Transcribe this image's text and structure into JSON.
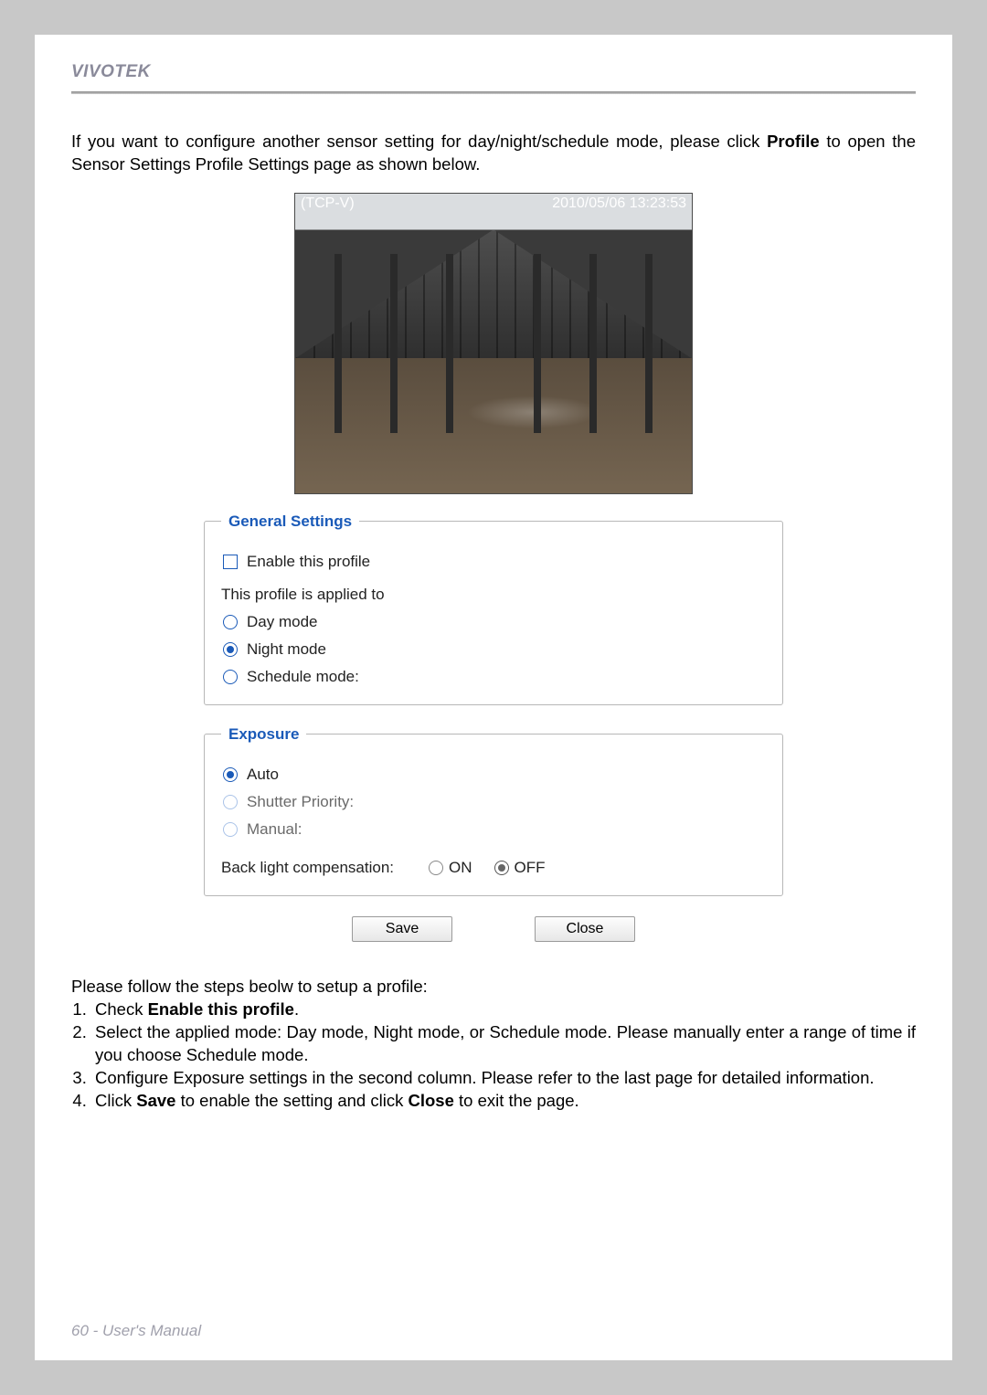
{
  "brand": "VIVOTEK",
  "intro_part1": "If you want to configure another sensor setting for day/night/schedule mode, please click ",
  "intro_profile": "Profile",
  "intro_part2": " to open the Sensor Settings Profile Settings page as shown below.",
  "camera": {
    "label_left": "(TCP-V)",
    "timestamp": "2010/05/06 13:23:53"
  },
  "general": {
    "legend": "General Settings",
    "enable_label": "Enable this profile",
    "applied_label": "This profile is applied to",
    "opt_day": "Day mode",
    "opt_night": "Night mode",
    "opt_schedule": "Schedule mode:"
  },
  "exposure": {
    "legend": "Exposure",
    "opt_auto": "Auto",
    "opt_shutter": "Shutter Priority:",
    "opt_manual": "Manual:",
    "blc_label": "Back light compensation:",
    "on": "ON",
    "off": "OFF"
  },
  "buttons": {
    "save": "Save",
    "close": "Close"
  },
  "steps_intro": "Please follow the steps beolw to setup a profile:",
  "steps": {
    "s1a": "Check ",
    "s1b": "Enable this profile",
    "s1c": ".",
    "s2": "Select the applied mode: Day mode, Night mode, or Schedule mode. Please manually enter a range of time if you choose Schedule mode.",
    "s3": "Configure Exposure settings in the second column. Please refer to the last page for detailed information.",
    "s4a": "Click ",
    "s4b": "Save",
    "s4c": " to enable the setting and click ",
    "s4d": "Close",
    "s4e": " to exit the page."
  },
  "footer": "60 - User's Manual"
}
